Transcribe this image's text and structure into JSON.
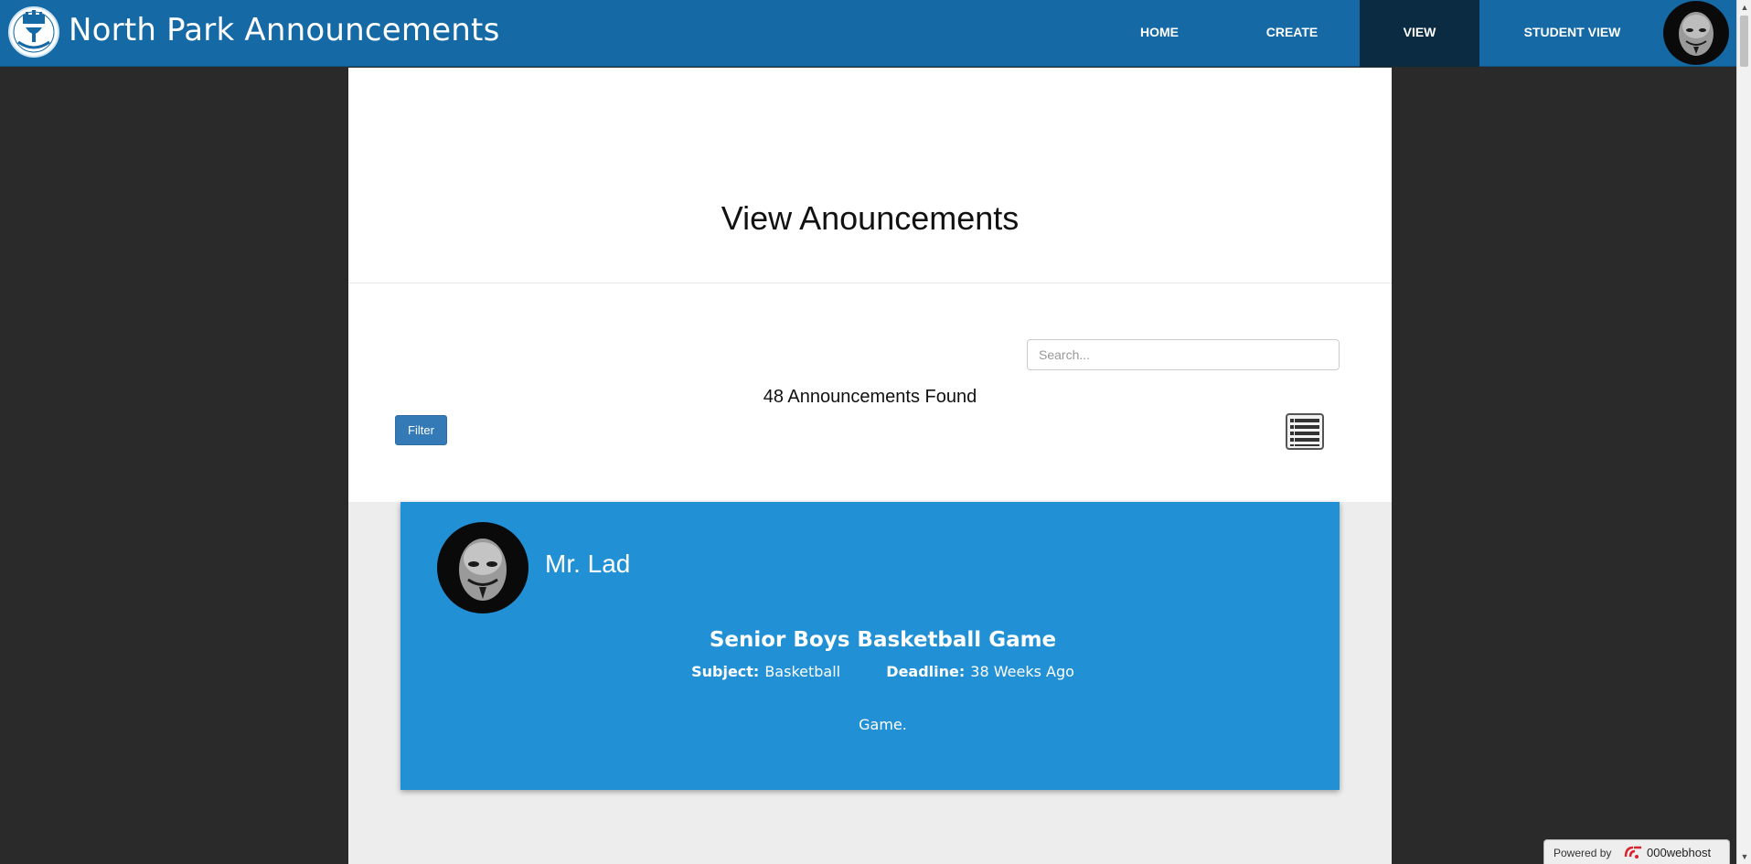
{
  "app": {
    "title": "North Park Announcements"
  },
  "nav": {
    "items": [
      {
        "label": "HOME"
      },
      {
        "label": "CREATE"
      },
      {
        "label": "VIEW"
      },
      {
        "label": "STUDENT VIEW"
      }
    ],
    "active": "VIEW"
  },
  "page": {
    "title": "View Anouncements"
  },
  "search": {
    "placeholder": "Search...",
    "value": ""
  },
  "results": {
    "count_text": "48 Announcements Found"
  },
  "toolbar": {
    "filter_label": "Filter",
    "view_icon": "list-view-icon"
  },
  "announcements": [
    {
      "author": "Mr. Lad",
      "title": "Senior Boys Basketball Game",
      "subject_label": "Subject:",
      "subject": "Basketball",
      "deadline_label": "Deadline:",
      "deadline": "38 Weeks Ago",
      "body": "Game."
    }
  ],
  "footer": {
    "powered_by": "Powered by",
    "brand": "000webhost"
  },
  "colors": {
    "navbar": "#156aa6",
    "nav_active": "#0b2b43",
    "card": "#2190d5",
    "button": "#337ab7",
    "background": "#2a2a2a"
  }
}
